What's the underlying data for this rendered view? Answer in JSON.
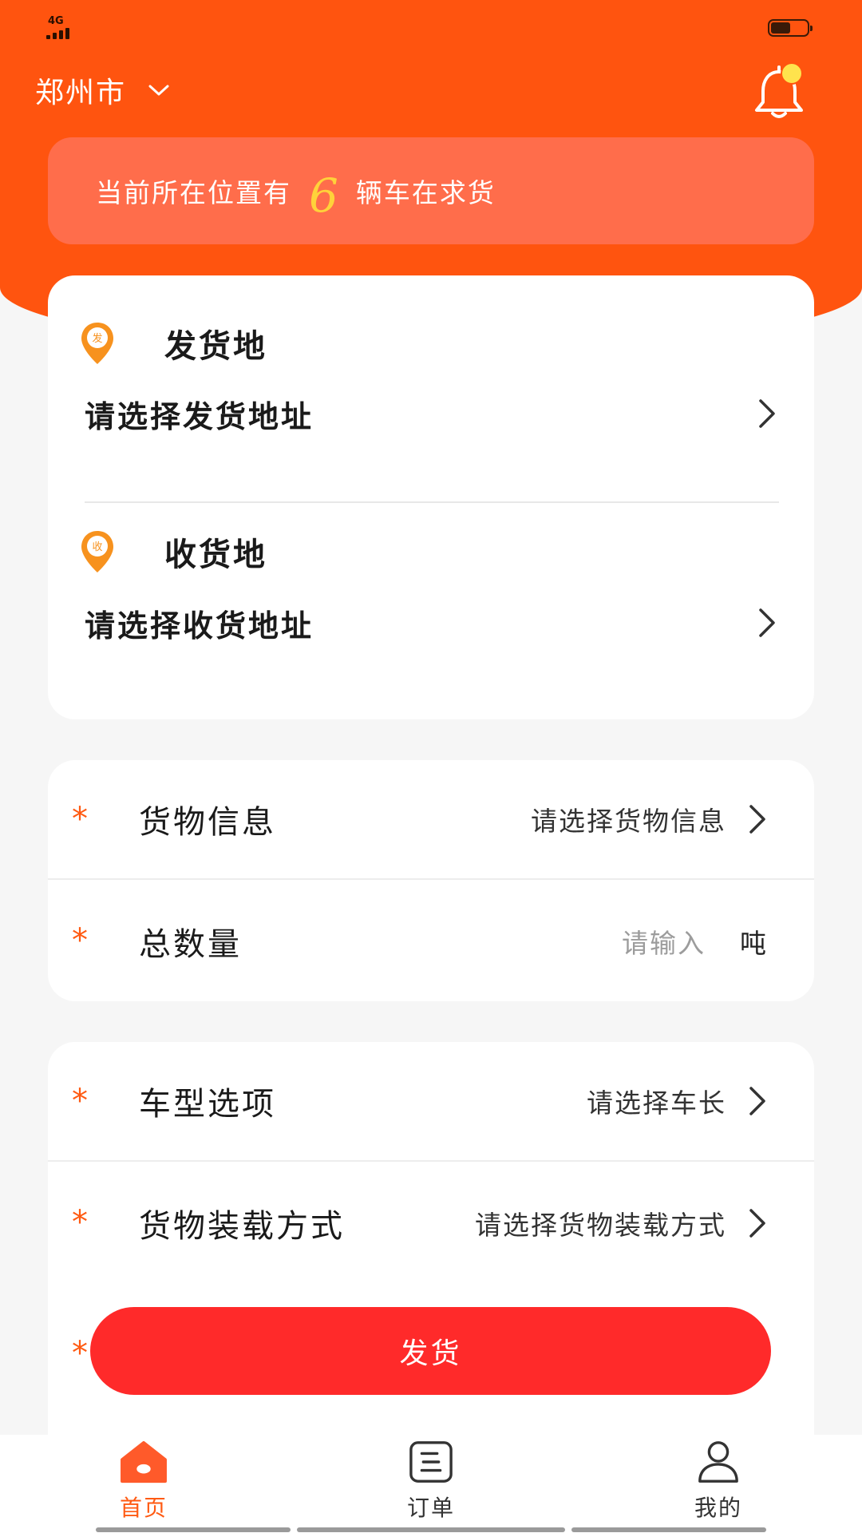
{
  "status_bar": {
    "network": "4G"
  },
  "header": {
    "city": "郑州市"
  },
  "banner": {
    "prefix": "当前所在位置有",
    "count": "6",
    "suffix": "辆车在求货"
  },
  "address": {
    "origin": {
      "badge": "发",
      "title": "发货地",
      "prompt": "请选择发货地址"
    },
    "destination": {
      "badge": "收",
      "title": "收货地",
      "prompt": "请选择收货地址"
    }
  },
  "cargo": {
    "info": {
      "required": "*",
      "label": "货物信息",
      "value": "请选择货物信息"
    },
    "quantity": {
      "required": "*",
      "label": "总数量",
      "placeholder": "请输入",
      "unit": "吨"
    }
  },
  "truck": {
    "type": {
      "required": "*",
      "label": "车型选项",
      "value": "请选择车长"
    },
    "loading": {
      "required": "*",
      "label": "货物装载方式",
      "value": "请选择货物装载方式"
    }
  },
  "submit": {
    "required": "*",
    "label": "发货"
  },
  "tabs": [
    {
      "label": "首页",
      "icon": "home-icon",
      "active": true
    },
    {
      "label": "订单",
      "icon": "order-icon",
      "active": false
    },
    {
      "label": "我的",
      "icon": "person-icon",
      "active": false
    }
  ],
  "colors": {
    "brand": "#ff540f",
    "banner": "#ff6d4b",
    "highlight": "#ffd23a",
    "button": "#ff2a2a"
  }
}
